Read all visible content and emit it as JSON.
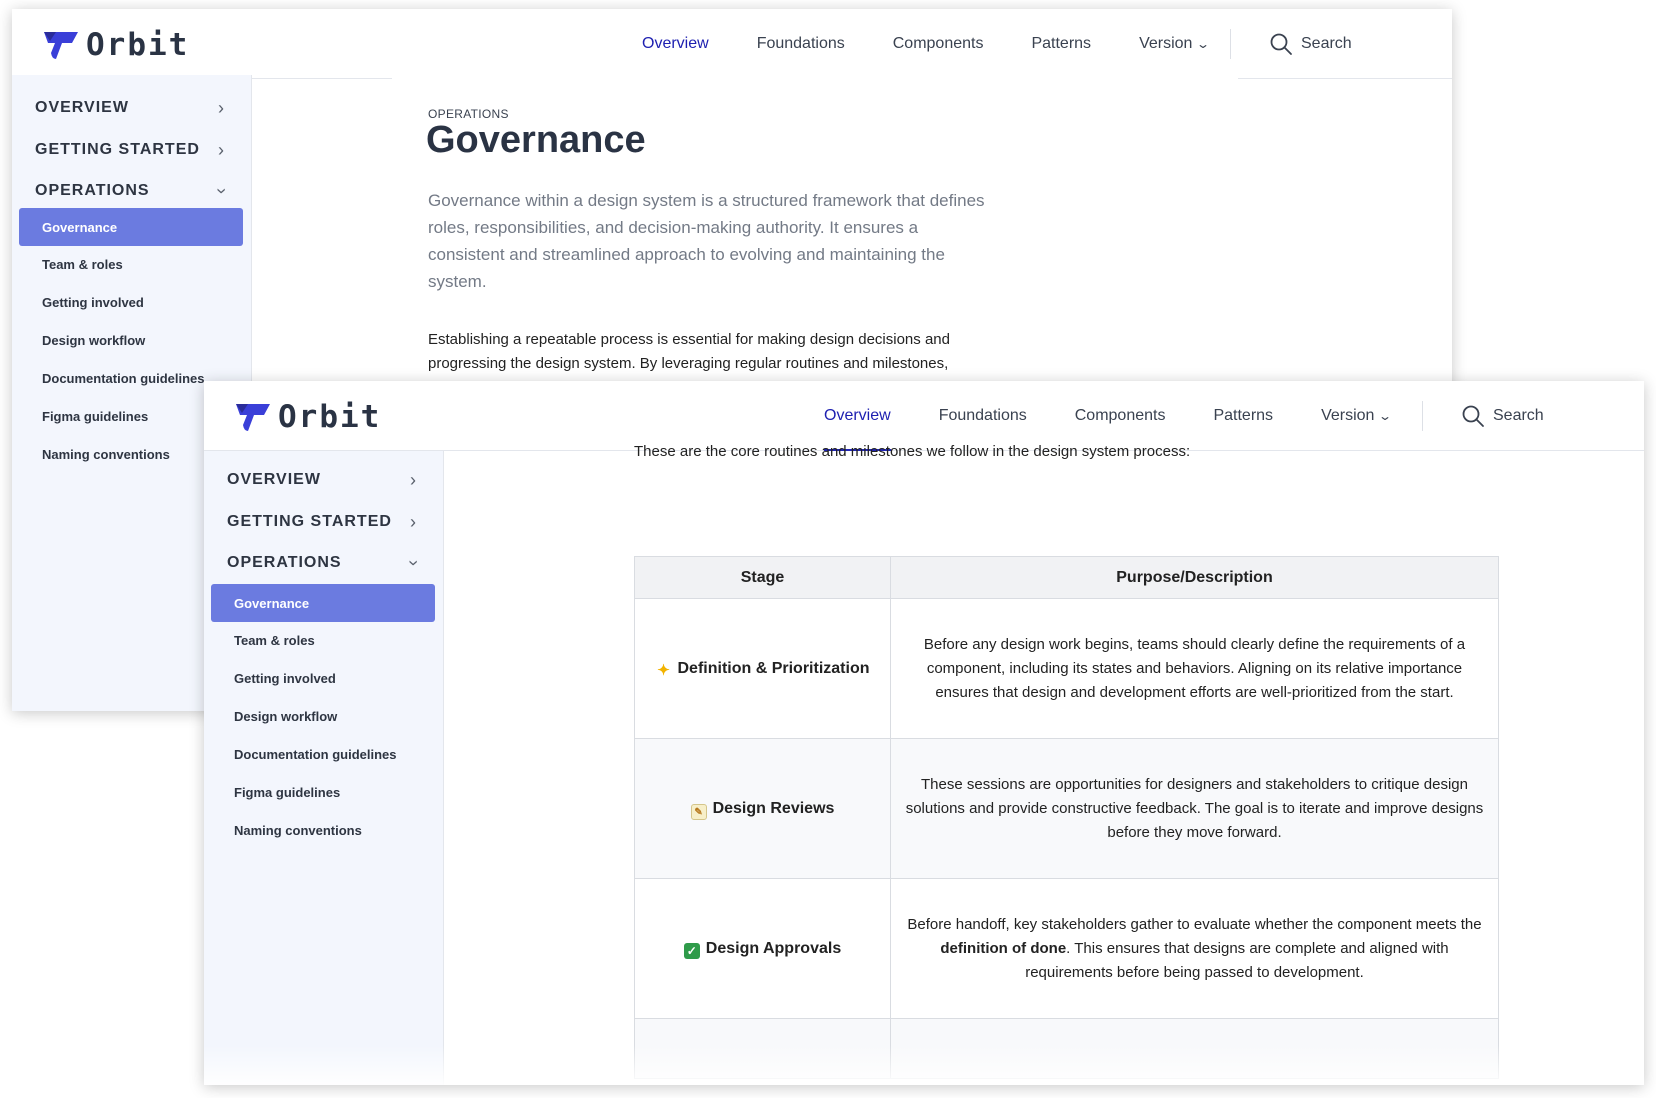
{
  "app": {
    "logo_text": "Orbit"
  },
  "nav": {
    "items": [
      "Overview",
      "Foundations",
      "Components",
      "Patterns",
      "Version"
    ],
    "active": "Overview",
    "search_label": "Search"
  },
  "sidebar": {
    "sections": [
      "OVERVIEW",
      "GETTING STARTED",
      "OPERATIONS"
    ],
    "items": [
      "Governance",
      "Team & roles",
      "Getting involved",
      "Design workflow",
      "Documentation guidelines",
      "Figma guidelines",
      "Naming conventions"
    ],
    "active": "Governance"
  },
  "page": {
    "breadcrumb": "OPERATIONS",
    "title": "Governance",
    "lead": "Governance within a design system is a structured framework that defines roles, responsibilities, and decision-making authority. It ensures a consistent and streamlined approach to evolving and maintaining the system.",
    "body": "Establishing a repeatable process is essential for making design decisions and progressing the design system. By leveraging regular routines and milestones,",
    "intro": "These are the core routines and milestones we follow in the design system process:"
  },
  "table": {
    "headers": [
      "Stage",
      "Purpose/Description"
    ],
    "rows": [
      {
        "icon": "sparkle-icon",
        "stage": "Definition & Prioritization",
        "description": "Before any design work begins, teams should clearly define the requirements of a component, including its states and behaviors. Aligning on its relative importance ensures that design and development efforts are well-prioritized from the start."
      },
      {
        "icon": "memo-icon",
        "stage": "Design Reviews",
        "description": "These sessions are opportunities for designers and stakeholders to critique design solutions and provide constructive feedback. The goal is to iterate and improve designs before they move forward."
      },
      {
        "icon": "check-icon",
        "stage": "Design Approvals",
        "description_before": "Before handoff, key stakeholders gather to evaluate whether the component meets the ",
        "description_bold": "definition of done",
        "description_after": ". This ensures that designs are complete and aligned with requirements before being passed to development."
      }
    ]
  },
  "colors": {
    "accent": "#2125b5",
    "sidebar_active": "#6b7be0",
    "sidebar_bg": "#f3f6fd",
    "logo": "#3a3fd8"
  }
}
